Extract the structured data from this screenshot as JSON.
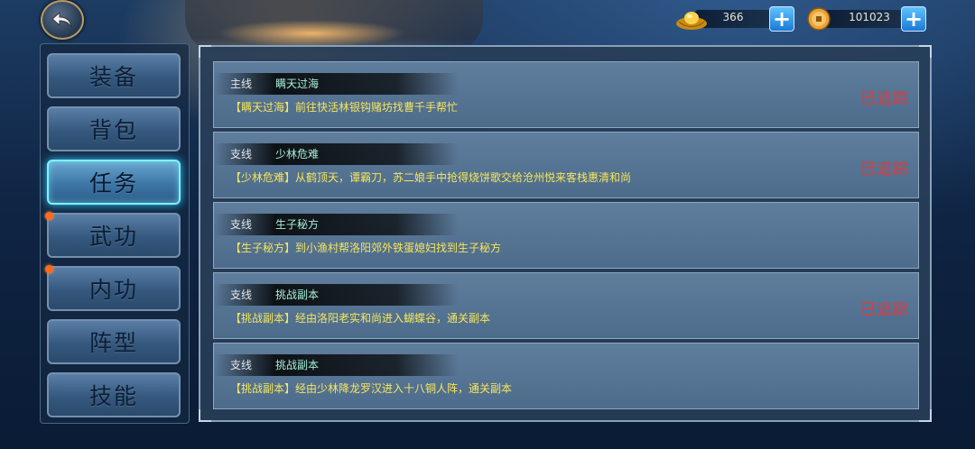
{
  "currency": {
    "ingot": {
      "icon": "gold-ingot-icon",
      "value": "366"
    },
    "coin": {
      "icon": "copper-coin-icon",
      "value": "101023"
    }
  },
  "tabs": [
    {
      "label": "装备",
      "active": false,
      "dot": false
    },
    {
      "label": "背包",
      "active": false,
      "dot": false
    },
    {
      "label": "任务",
      "active": true,
      "dot": false
    },
    {
      "label": "武功",
      "active": false,
      "dot": true
    },
    {
      "label": "内功",
      "active": false,
      "dot": true
    },
    {
      "label": "阵型",
      "active": false,
      "dot": false
    },
    {
      "label": "技能",
      "active": false,
      "dot": false
    }
  ],
  "quests": [
    {
      "type": "主线",
      "name": "瞒天过海",
      "desc": "【瞒天过海】前往快活林银钩赌坊找曹千手帮忙",
      "tracked": "已追踪"
    },
    {
      "type": "支线",
      "name": "少林危难",
      "desc": "【少林危难】从鹤顶天，谭霸刀，苏二娘手中抢得烧饼歌交给沧州悦来客栈惠清和尚",
      "tracked": "已追踪"
    },
    {
      "type": "支线",
      "name": "生子秘方",
      "desc": "【生子秘方】到小渔村帮洛阳郊外铁蛋媳妇找到生子秘方",
      "tracked": ""
    },
    {
      "type": "支线",
      "name": "挑战副本",
      "desc": "【挑战副本】经由洛阳老实和尚进入蝴蝶谷，通关副本",
      "tracked": "已追踪"
    },
    {
      "type": "支线",
      "name": "挑战副本",
      "desc": "【挑战副本】经由少林降龙罗汉进入十八铜人阵，通关副本",
      "tracked": ""
    }
  ],
  "colors": {
    "tracked": "#e23a3a",
    "quest_name": "#a7f0d8",
    "quest_desc": "#f7e65a",
    "active_glow": "#31c8ff"
  }
}
